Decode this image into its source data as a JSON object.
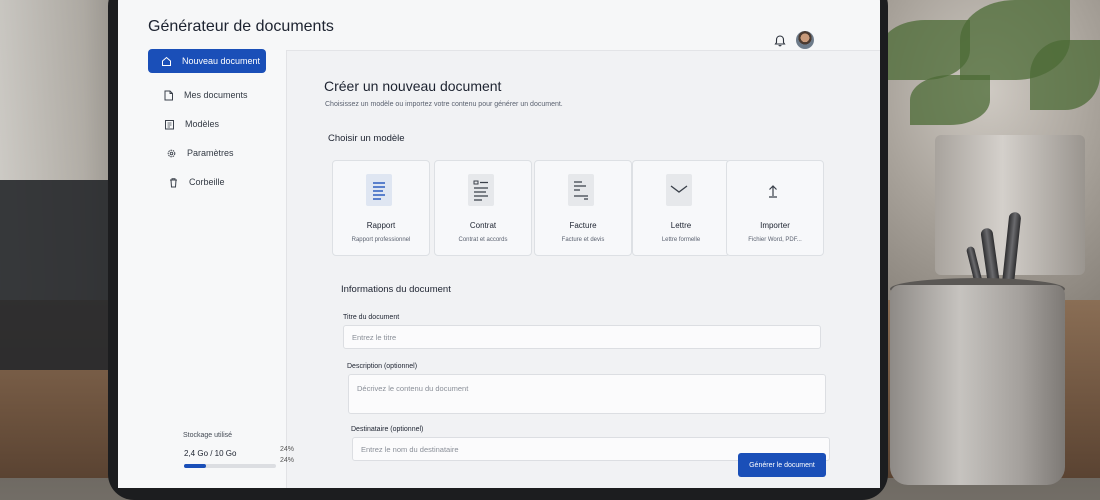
{
  "app": {
    "title": "Générateur de documents"
  },
  "header": {
    "bell_icon": "bell-icon",
    "avatar": "user-avatar"
  },
  "sidebar": {
    "items": [
      {
        "label": "Nouveau document",
        "icon": "home-icon",
        "active": true
      },
      {
        "label": "Mes documents",
        "icon": "document-icon",
        "active": false
      },
      {
        "label": "Modèles",
        "icon": "template-icon",
        "active": false
      },
      {
        "label": "Paramètres",
        "icon": "gear-icon",
        "active": false
      },
      {
        "label": "Corbeille",
        "icon": "trash-icon",
        "active": false
      }
    ],
    "storage": {
      "label": "Stockage utilisé",
      "value": "2,4 Go / 10 Go",
      "percent_text_1": "24%",
      "percent_text_2": "24%",
      "fraction": 0.24
    }
  },
  "main": {
    "title": "Créer un nouveau document",
    "subtitle": "Choisissez un modèle ou importez votre contenu pour générer un document.",
    "choose_section": "Choisir un modèle",
    "templates": [
      {
        "name": "Rapport",
        "desc": "Rapport professionnel",
        "icon": "report-icon"
      },
      {
        "name": "Contrat",
        "desc": "Contrat et accords",
        "icon": "contract-icon"
      },
      {
        "name": "Facture",
        "desc": "Facture et devis",
        "icon": "invoice-icon"
      },
      {
        "name": "Lettre",
        "desc": "Lettre formelle",
        "icon": "letter-icon"
      },
      {
        "name": "Importer",
        "desc": "Fichier Word, PDF...",
        "icon": "upload-icon"
      }
    ],
    "info_section": "Informations du document",
    "fields": {
      "title_label": "Titre du document",
      "title_placeholder": "Entrez le titre",
      "description_label": "Description (optionnel)",
      "description_placeholder": "Décrivez le contenu du document",
      "recipient_label": "Destinataire (optionnel)",
      "recipient_placeholder": "Entrez le nom du destinataire"
    },
    "submit_label": "Générer le document"
  },
  "colors": {
    "accent": "#1a4fb8",
    "bezel": "#1c1d1f",
    "screen_bg": "#f1f2f4"
  }
}
